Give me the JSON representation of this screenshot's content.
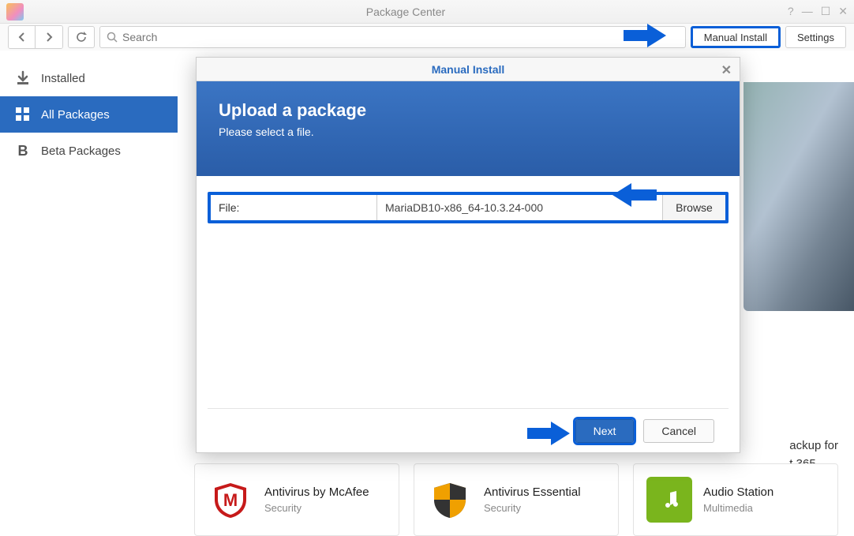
{
  "titlebar": {
    "title": "Package Center"
  },
  "toolbar": {
    "search_placeholder": "Search",
    "manual_install": "Manual Install",
    "settings": "Settings"
  },
  "sidebar": {
    "items": [
      {
        "label": "Installed"
      },
      {
        "label": "All Packages"
      },
      {
        "label": "Beta Packages"
      }
    ]
  },
  "promo": {
    "line1": "ackup for",
    "line2": "t 365"
  },
  "packages": [
    {
      "name": "Antivirus by McAfee",
      "category": "Security"
    },
    {
      "name": "Antivirus Essential",
      "category": "Security"
    },
    {
      "name": "Audio Station",
      "category": "Multimedia"
    }
  ],
  "modal": {
    "title": "Manual Install",
    "hero_title": "Upload a package",
    "hero_sub": "Please select a file.",
    "file_label": "File:",
    "file_value": "MariaDB10-x86_64-10.3.24-000",
    "browse": "Browse",
    "next": "Next",
    "cancel": "Cancel"
  }
}
